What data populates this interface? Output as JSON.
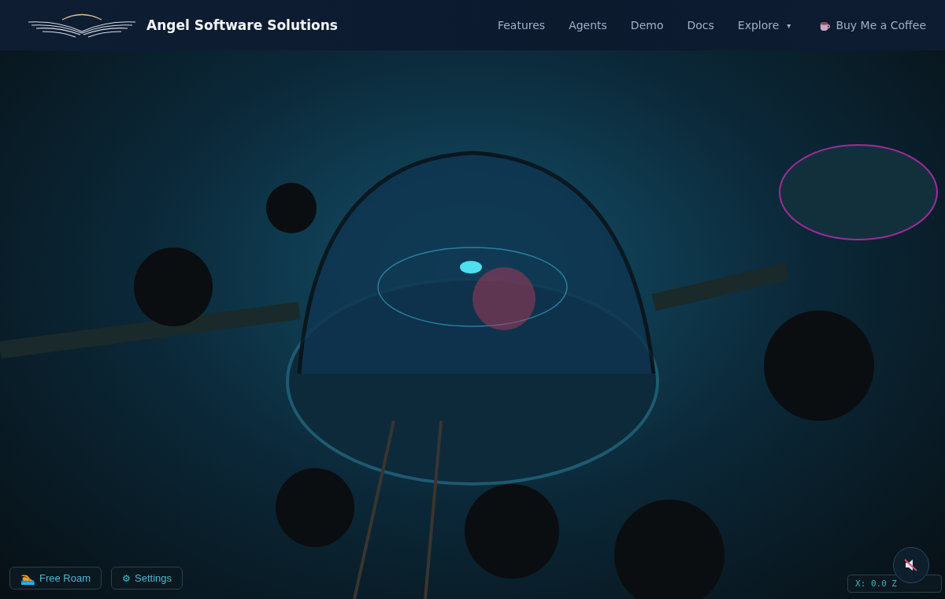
{
  "header": {
    "brand": "Angel Software Solutions",
    "nav": [
      {
        "label": "Features",
        "kind": "link"
      },
      {
        "label": "Agents",
        "kind": "link"
      },
      {
        "label": "Demo",
        "kind": "link"
      },
      {
        "label": "Docs",
        "kind": "link"
      },
      {
        "label": "Explore",
        "kind": "dropdown",
        "caret": "▾"
      },
      {
        "label": "Buy Me a Coffee",
        "kind": "coffee"
      }
    ]
  },
  "controls": [
    {
      "label": "Free Roam",
      "icon": "🏊",
      "kind": "emoji"
    },
    {
      "label": "Settings",
      "icon": "⚙",
      "kind": "glyph"
    }
  ],
  "coordinates": "X: 0.0 Z",
  "sound": {
    "muted": true
  }
}
